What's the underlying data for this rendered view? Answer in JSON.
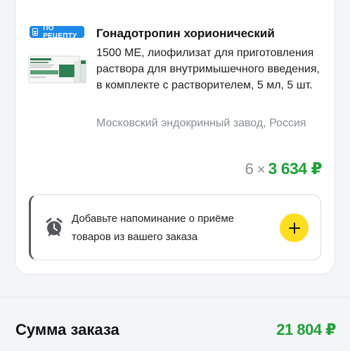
{
  "item": {
    "rx_badge": "ПО РЕЦЕПТУ",
    "name": "Гонадотропин хорионический",
    "description": "1500 МЕ, лиофилизат для приготовления раствора для внутримышечного введения, в комплекте с растворителем, 5 мл, 5 шт.",
    "manufacturer": "Московский эндокринный завод, Россия",
    "quantity": "6",
    "times": "×",
    "price": "3 634 ₽"
  },
  "reminder": {
    "text": "Добавьте напоминание о приёме товаров из вашего заказа",
    "add_icon": "plus-icon",
    "clock_icon": "alarm-clock-icon"
  },
  "summary": {
    "label": "Сумма заказа",
    "total": "21 804 ₽"
  },
  "colors": {
    "accent_green": "#21a038",
    "badge_blue": "#1e88e5",
    "button_yellow": "#ffde21",
    "muted_gray": "#8a8d91"
  }
}
